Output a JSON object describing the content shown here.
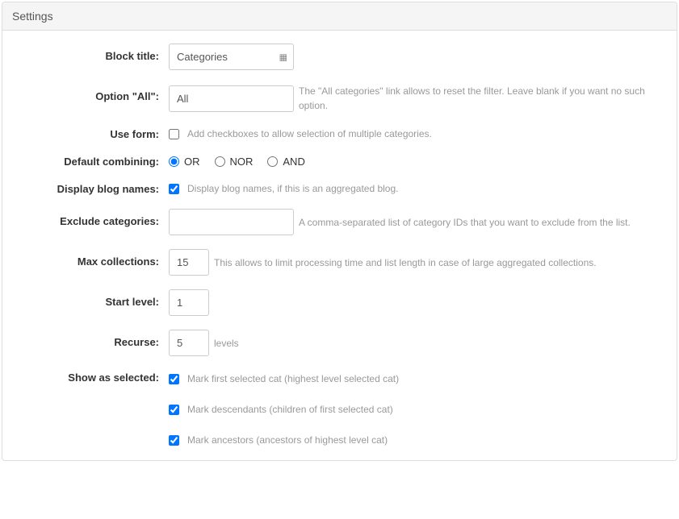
{
  "panel": {
    "title": "Settings"
  },
  "block_title": {
    "label": "Block title:",
    "value": "Categories"
  },
  "option_all": {
    "label": "Option \"All\":",
    "value": "All",
    "help": "The \"All categories\" link allows to reset the filter. Leave blank if you want no such option."
  },
  "use_form": {
    "label": "Use form:",
    "help": "Add checkboxes to allow selection of multiple categories."
  },
  "default_combining": {
    "label": "Default combining:",
    "options": {
      "or": "OR",
      "nor": "NOR",
      "and": "AND"
    }
  },
  "display_blog_names": {
    "label": "Display blog names:",
    "help": "Display blog names, if this is an aggregated blog."
  },
  "exclude_categories": {
    "label": "Exclude categories:",
    "help": "A comma-separated list of category IDs that you want to exclude from the list."
  },
  "max_collections": {
    "label": "Max collections:",
    "value": "15",
    "help": "This allows to limit processing time and list length in case of large aggregated collections."
  },
  "start_level": {
    "label": "Start level:",
    "value": "1"
  },
  "recurse": {
    "label": "Recurse:",
    "value": "5",
    "suffix": "levels"
  },
  "show_as_selected": {
    "label": "Show as selected:",
    "mark_first": "Mark first selected cat (highest level selected cat)",
    "mark_descendants": "Mark descendants (children of first selected cat)",
    "mark_ancestors": "Mark ancestors (ancestors of highest level cat)"
  }
}
